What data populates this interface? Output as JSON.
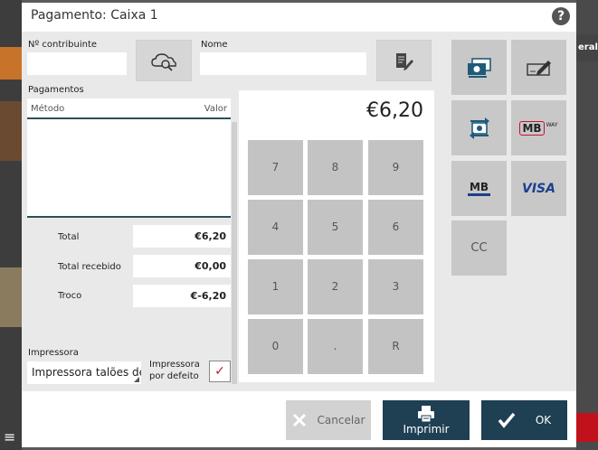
{
  "background": {
    "right_strip_text": "eral"
  },
  "dialog": {
    "title": "Pagamento: Caixa 1",
    "help_icon": "question-icon"
  },
  "contribuinte": {
    "label": "Nº contribuinte",
    "value": "",
    "search_icon": "cloud-search-icon"
  },
  "nome": {
    "label": "Nome",
    "value": "",
    "edit_icon": "edit-document-icon"
  },
  "pagamentos": {
    "label": "Pagamentos",
    "columns": [
      "Método",
      "Valor"
    ],
    "rows": []
  },
  "summary": {
    "total_label": "Total",
    "total_value": "€6,20",
    "received_label": "Total recebido",
    "received_value": "€0,00",
    "change_label": "Troco",
    "change_value": "€-6,20"
  },
  "printer": {
    "label": "Impressora",
    "selected": "Impressora talões de",
    "default_label_line1": "Impressora",
    "default_label_line2": "por defeito",
    "default_checked": true,
    "check_icon": "checkmark-icon"
  },
  "keypad": {
    "amount": "€6,20",
    "keys": [
      "7",
      "8",
      "9",
      "4",
      "5",
      "6",
      "1",
      "2",
      "3",
      "0",
      ".",
      "R"
    ]
  },
  "payment_methods": {
    "cash_icon": "cash-icon",
    "cheque_icon": "cheque-icon",
    "transfer_icon": "transfer-icon",
    "mbway_text": "MB",
    "mbway_small": "WAY",
    "mb_text": "MB",
    "visa_text": "VISA",
    "cc_text": "CC"
  },
  "footer": {
    "cancel_label": "Cancelar",
    "print_label": "Imprimir",
    "ok_label": "OK",
    "cancel_icon": "close-icon",
    "print_icon": "printer-icon",
    "ok_icon": "checkmark-icon"
  },
  "colors": {
    "primary": "#1f3f53",
    "accent_red": "#c8102e",
    "visa_blue": "#1a3f8f",
    "cash_blue": "#1e5a7a"
  }
}
